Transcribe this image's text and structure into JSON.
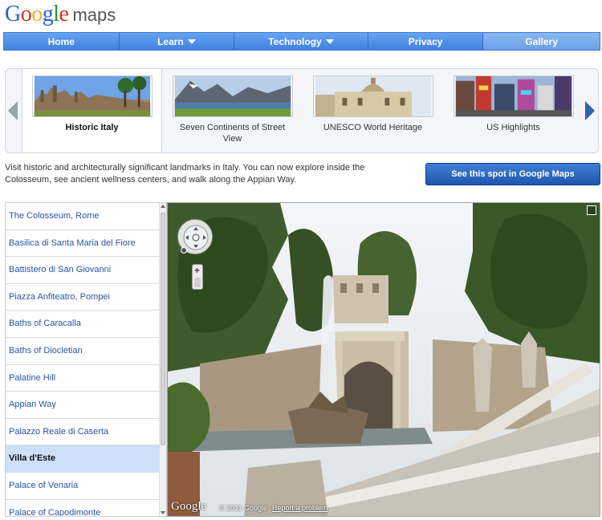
{
  "logo": {
    "letters": [
      {
        "ch": "G",
        "color": "#2a5fcf"
      },
      {
        "ch": "o",
        "color": "#d4322b"
      },
      {
        "ch": "o",
        "color": "#f2b21b"
      },
      {
        "ch": "g",
        "color": "#2a5fcf"
      },
      {
        "ch": "l",
        "color": "#1a9a3f"
      },
      {
        "ch": "e",
        "color": "#d4322b"
      }
    ],
    "product": "maps"
  },
  "nav": {
    "items": [
      {
        "label": "Home",
        "dropdown": false,
        "active": false
      },
      {
        "label": "Learn",
        "dropdown": true,
        "active": false
      },
      {
        "label": "Technology",
        "dropdown": true,
        "active": false
      },
      {
        "label": "Privacy",
        "dropdown": false,
        "active": false
      },
      {
        "label": "Gallery",
        "dropdown": false,
        "active": true
      }
    ]
  },
  "carousel": {
    "slides": [
      {
        "label": "Historic Italy",
        "active": true
      },
      {
        "label": "Seven Continents of Street View",
        "active": false
      },
      {
        "label": "UNESCO World Heritage",
        "active": false
      },
      {
        "label": "US Highlights",
        "active": false
      }
    ]
  },
  "description": "Visit historic and architecturally significant landmarks in Italy. You can now explore inside the Colosseum, see ancient wellness centers, and walk along the Appian Way.",
  "maps_button": "See this spot in Google Maps",
  "places": [
    {
      "name": "The Colosseum, Rome",
      "selected": false
    },
    {
      "name": "Basilica di Santa Maria del Fiore",
      "selected": false
    },
    {
      "name": "Battistero di San Giovanni",
      "selected": false
    },
    {
      "name": "Piazza Anfiteatro, Pompei",
      "selected": false
    },
    {
      "name": "Baths of Caracalla",
      "selected": false
    },
    {
      "name": "Baths of Diocletian",
      "selected": false
    },
    {
      "name": "Palatine Hill",
      "selected": false
    },
    {
      "name": "Appian Way",
      "selected": false
    },
    {
      "name": "Palazzo Reale di Caserta",
      "selected": false
    },
    {
      "name": "Villa d'Este",
      "selected": true
    },
    {
      "name": "Palace of Venaria",
      "selected": false
    },
    {
      "name": "Palace of Capodimonte",
      "selected": false
    }
  ],
  "streetview": {
    "logo": "Google",
    "copyright": "© 2011 Google",
    "report_link": "Report a problem"
  },
  "colors": {
    "nav_blue": "#3f82e0",
    "link_blue": "#2855a3",
    "selected_bg": "#cde0fa",
    "button_blue": "#1f56ad"
  }
}
